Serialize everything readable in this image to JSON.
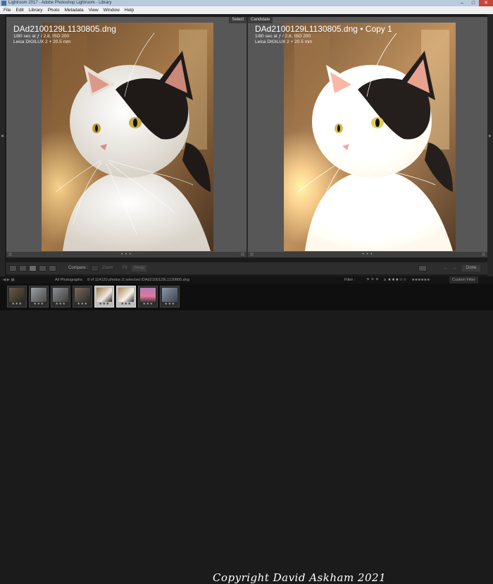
{
  "window": {
    "title": "Lightroom 2017 - Adobe Photoshop Lightroom - Library",
    "controls": {
      "minimize": "–",
      "maximize": "□",
      "close": "✕"
    }
  },
  "menu": [
    "File",
    "Edit",
    "Library",
    "Photo",
    "Metadata",
    "View",
    "Window",
    "Help"
  ],
  "select_pane": {
    "tag": "Select",
    "filename": "DAd2100129L1130805.dng",
    "line1": "1/80 sec at ƒ / 2.8, ISO 200",
    "line2": "Leica DIGILUX 2 + 20.5 mm"
  },
  "candidate_pane": {
    "tag": "Candidate",
    "filename": "DAd2100129L1130805.dng • Copy 1",
    "line1": "1/80 sec at ƒ / 2.8, ISO 200",
    "line2": "Leica DIGILUX 2 + 20.5 mm"
  },
  "pane_footer_dots": "• • •",
  "toolbar": {
    "compare_label": "Compare :",
    "zoom_label": "Zoom",
    "fit_label": "Fit",
    "swap_label": "Swap",
    "done_label": "Done",
    "filter_label": "Filter :",
    "custom_filter_label": "Custom Filter"
  },
  "filmstrip_bar": {
    "source": "All Photographs",
    "count": "8 of 114120 photos /2 selected /DAd2100129L1130805.dng",
    "filter_label": "Filter :",
    "custom_filter": "Custom Filter"
  },
  "thumbnails": [
    {
      "stars": "★★★",
      "selected": false
    },
    {
      "stars": "★★★",
      "selected": false
    },
    {
      "stars": "★★★",
      "selected": false
    },
    {
      "stars": "★★★",
      "selected": false
    },
    {
      "stars": "★★★",
      "selected": true
    },
    {
      "stars": "★★★",
      "selected": true
    },
    {
      "stars": "★★★",
      "selected": false
    },
    {
      "stars": "★★★",
      "selected": false
    }
  ],
  "copyright": "Copyright David Askham 2021",
  "colors": {
    "pane_bg": "#575757",
    "titlebar": "#b8cadc",
    "close_button": "#c9453a"
  }
}
